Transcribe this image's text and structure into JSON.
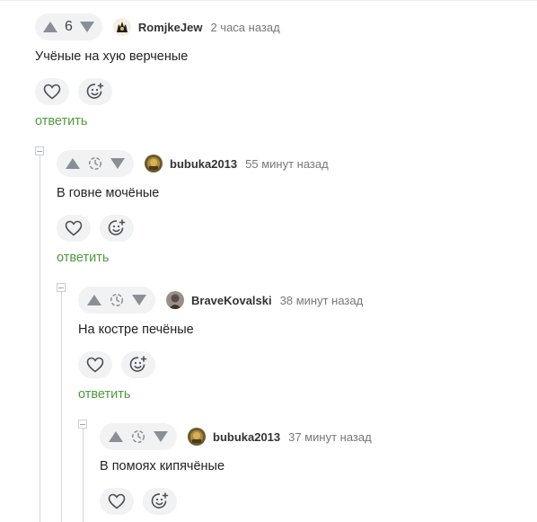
{
  "comments": [
    {
      "score": "6",
      "author": "RomjkeJew",
      "time": "2 часа назад",
      "text": "Учёные на хую верченые",
      "reply_label": "ответить"
    },
    {
      "author": "bubuka2013",
      "time": "55 минут назад",
      "text": "В говне мочёные",
      "reply_label": "ответить"
    },
    {
      "author": "BraveKovalski",
      "time": "38 минут назад",
      "text": "На костре печёные",
      "reply_label": "ответить"
    },
    {
      "author": "bubuka2013",
      "time": "37 минут назад",
      "text": "В помоях кипячёные"
    }
  ],
  "icons": {
    "upvote": "triangle-up-icon",
    "downvote": "triangle-down-icon",
    "pending": "clock-icon",
    "like": "heart-icon",
    "react": "emoji-add-icon",
    "collapse": "minus-box-icon"
  },
  "colors": {
    "accent_green": "#4f9a3e",
    "pill_bg": "#f1f2f4",
    "icon_gray": "#8a8f96"
  }
}
